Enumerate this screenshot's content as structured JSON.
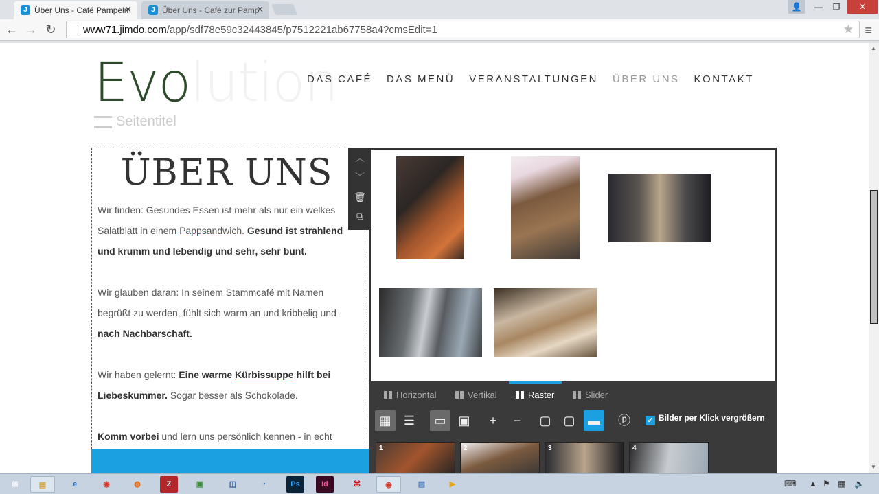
{
  "browser": {
    "tabs": [
      {
        "title": "Über Uns - Café Pampelm",
        "active": true
      },
      {
        "title": "Über Uns - Café zur Pamp",
        "active": false
      }
    ],
    "url_host": "www71.jimdo.com",
    "url_path": "/app/sdf78e59c32443845/p7512221ab67758a4?cmsEdit=1"
  },
  "site": {
    "logo_strong": "Evo",
    "logo_faded": "lution",
    "nav": [
      "DAS CAFÉ",
      "DAS MENÜ",
      "VERANSTALTUNGEN",
      "ÜBER UNS",
      "KONTAKT"
    ],
    "current_nav": "ÜBER UNS",
    "page_title_placeholder": "Seitentitel"
  },
  "content": {
    "heading": "ÜBER UNS",
    "p1_a": "Wir finden: Gesundes Essen ist mehr als nur ein welkes Salatblatt in einem ",
    "p1_link": "Pappsandwich",
    "p1_b": ". ",
    "p1_bold": "Gesund ist strahlend und krumm und lebendig und sehr, sehr bunt.",
    "p2_a": "Wir glauben daran: In seinem Stammcafé mit Namen begrüßt zu werden, fühlt sich warm an und kribbelig und ",
    "p2_bold": "nach Nachbarschaft.",
    "p3_a": "Wir haben gelernt: ",
    "p3_bold1": "Eine warme ",
    "p3_link": "Kürbissuppe",
    "p3_bold2": " hilft bei Liebeskummer.",
    "p3_b": " Sogar besser als Schokolade.",
    "p4_bold": "Komm vorbei",
    "p4_a": " und lern uns persönlich kennen - in echt"
  },
  "gallery": {
    "layout_tabs": [
      "Horizontal",
      "Vertikal",
      "Raster",
      "Slider"
    ],
    "selected_tab": "Raster",
    "enlarge_label": "Bilder per Klick vergrößern",
    "enlarge_checked": true,
    "thumb_numbers": [
      "1",
      "2",
      "3",
      "4"
    ]
  },
  "colors": {
    "accent": "#1ba0e1",
    "logo": "#2d4a2b",
    "panel": "#3a3a3a"
  },
  "icons": {
    "grid": "grid-icon",
    "list": "list-icon",
    "trash": "trash-icon",
    "copy": "copy-icon",
    "pinterest": "pinterest-icon",
    "check": "check-icon"
  }
}
